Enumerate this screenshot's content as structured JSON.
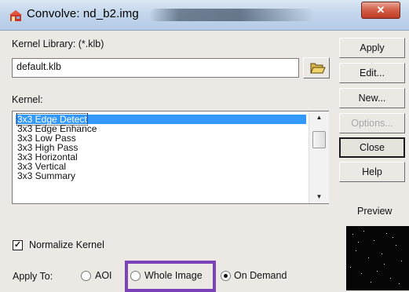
{
  "window": {
    "title": "Convolve: nd_b2.img",
    "close_glyph": "✕"
  },
  "library": {
    "label": "Kernel Library: (*.klb)",
    "value": "default.klb"
  },
  "kernel": {
    "label": "Kernel:",
    "items": [
      "3x3 Edge Detect",
      "3x3 Edge Enhance",
      "3x3 Low Pass",
      "3x3 High Pass",
      "3x3 Horizontal",
      "3x3 Vertical",
      "3x3 Summary"
    ],
    "selected_index": 0
  },
  "options": {
    "normalize_label": "Normalize Kernel",
    "normalize_checked": true,
    "apply_to_label": "Apply To:",
    "apply_to_options": [
      "AOI",
      "Whole Image",
      "On Demand"
    ],
    "apply_to_selected": "On Demand",
    "highlighted_option": "Whole Image",
    "highlight_color": "#7b42b9"
  },
  "buttons": {
    "apply": "Apply",
    "edit": "Edit...",
    "new": "New...",
    "options": "Options...",
    "close": "Close",
    "help": "Help"
  },
  "preview": {
    "label": "Preview"
  },
  "icons": {
    "app": "convolve-app-icon",
    "folder": "folder-open-icon",
    "scroll_up": "scroll-up-arrow-icon",
    "scroll_down": "scroll-down-arrow-icon",
    "check": "check-icon"
  },
  "colors": {
    "selection": "#3399ff",
    "titlebar": "#c3d6ec",
    "close_button": "#c9452d",
    "dialog_bg": "#ece9e4"
  }
}
